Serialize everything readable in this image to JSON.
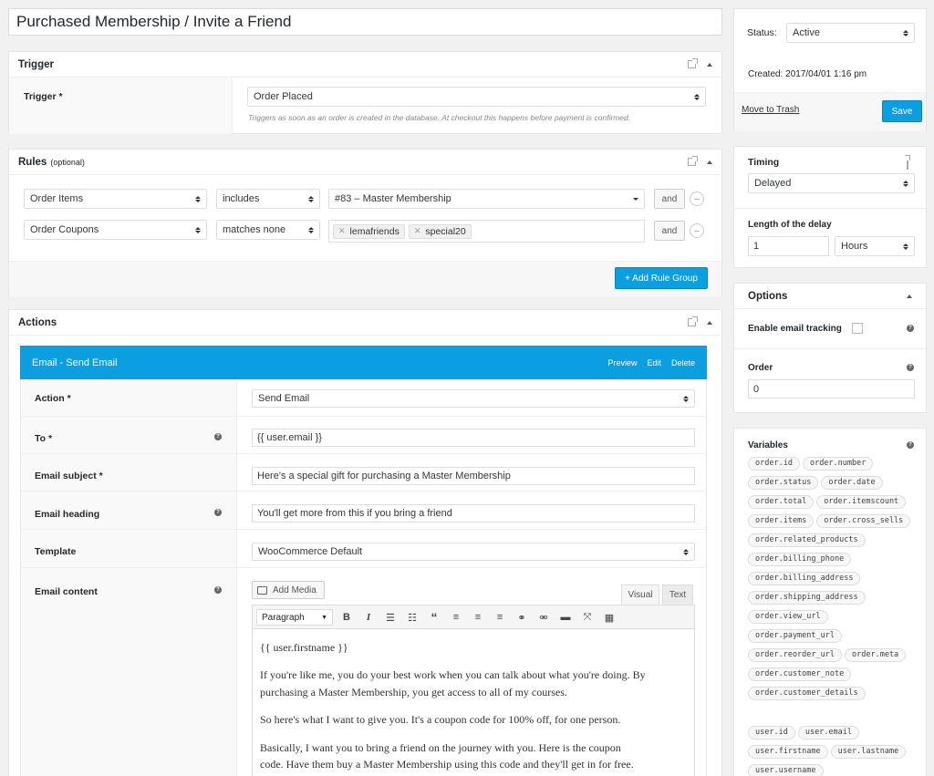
{
  "title": "Purchased Membership / Invite a Friend",
  "trigger": {
    "header": "Trigger",
    "label": "Trigger *",
    "value": "Order Placed",
    "help": "Triggers as soon as an order is created in the database. At checkout this happens before payment is confirmed."
  },
  "rules": {
    "header": "Rules",
    "optional": "(optional)",
    "rows": [
      {
        "field": "Order Items",
        "compare": "includes",
        "and": "and"
      },
      {
        "field": "Order Coupons",
        "compare": "matches none",
        "and": "and"
      }
    ],
    "row1_value": "#83 – Master Membership",
    "tags": [
      "lemafriends",
      "special20"
    ],
    "add_group": "+ Add Rule Group"
  },
  "actions": {
    "header": "Actions",
    "bar_title": "Email - Send Email",
    "preview": "Preview",
    "edit": "Edit",
    "delete": "Delete",
    "fields": {
      "action_label": "Action *",
      "action_value": "Send Email",
      "to_label": "To *",
      "to_value": "{{ user.email }}",
      "subject_label": "Email subject *",
      "subject_value": "Here's a special gift for purchasing a Master Membership",
      "heading_label": "Email heading",
      "heading_value": "You'll get more from this if you bring a friend",
      "template_label": "Template",
      "template_value": "WooCommerce Default",
      "content_label": "Email content"
    },
    "editor": {
      "add_media": "Add Media",
      "tab_visual": "Visual",
      "tab_text": "Text",
      "format": "Paragraph",
      "lines": [
        "{{ user.firstname }}",
        "If you're like me, you do your best work when you can talk about what you're doing. By",
        "purchasing a Master Membership, you get access to all of my courses.",
        "So here's what I want to give you. It's a coupon code for 100% off, for one person.",
        "Basically, I want you to bring a friend on the journey with you. Here is the coupon",
        "code. Have them buy a Master Membership using this code and they'll get in for free."
      ]
    }
  },
  "status": {
    "label": "Status:",
    "value": "Active",
    "created": "Created: 2017/04/01 1:16 pm",
    "trash": "Move to Trash",
    "save": "Save"
  },
  "timing": {
    "header": "Timing",
    "value": "Delayed",
    "delay_label": "Length of the delay",
    "delay_value": "1",
    "unit": "Hours"
  },
  "options": {
    "header": "Options",
    "tracking_label": "Enable email tracking",
    "order_label": "Order",
    "order_value": "0"
  },
  "variables": {
    "header": "Variables",
    "order": [
      "order.id",
      "order.number",
      "order.status",
      "order.date",
      "order.total",
      "order.itemscount",
      "order.items",
      "order.cross_sells",
      "order.related_products",
      "order.billing_phone",
      "order.billing_address",
      "order.shipping_address",
      "order.view_url",
      "order.payment_url",
      "order.reorder_url",
      "order.meta",
      "order.customer_note",
      "order.customer_details"
    ],
    "user": [
      "user.id",
      "user.email",
      "user.firstname",
      "user.lastname",
      "user.username"
    ]
  }
}
